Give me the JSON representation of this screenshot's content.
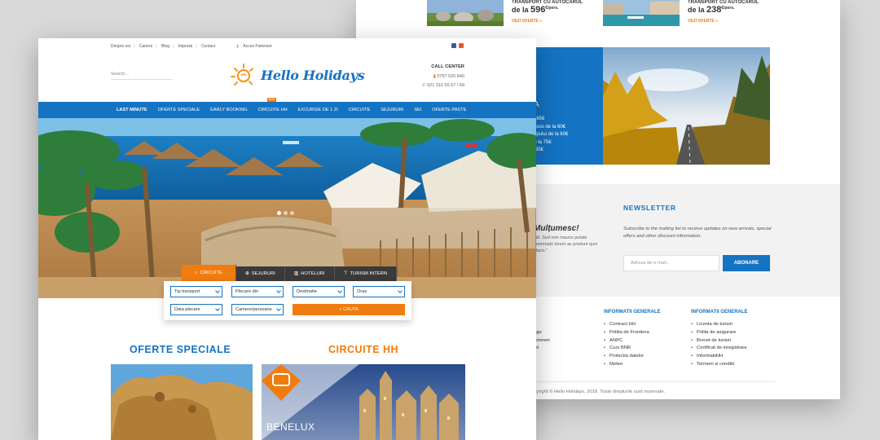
{
  "back": {
    "cards": [
      {
        "title": "TRANSPORT CU AUTOCARUL",
        "price_prefix": "de la",
        "price": "596",
        "price_unit": "€/pers.",
        "more": "VEZI OFERTE »"
      },
      {
        "title": "TRANSPORT CU AUTOCARUL",
        "price_prefix": "de la",
        "price": "238",
        "price_unit": "€/pers.",
        "more": "VEZI OFERTE »"
      }
    ],
    "promo": {
      "title_fragment": "IA",
      "lines": [
        "la 65€",
        "essos de la 60€",
        "impului de la 60€",
        "de la 75€",
        "a 95€"
      ]
    },
    "newsletter": {
      "title": "NEWSLETTER",
      "text": "Subscribe to the mailing list to receive updates on new arrivals, special offers and other discount information.",
      "placeholder": "Adresa de e-mail...",
      "button": "ABONARE"
    },
    "quote": {
      "title": "Mulțumesc!",
      "body": "elit. Sed non mauris putate commodo lorem ac pretium quis libero.\""
    },
    "footer": {
      "col0": [
        "p",
        "age",
        "arteneri",
        "ari",
        "t"
      ],
      "col1_title": "INFORMATII GENERALE",
      "col1": [
        "Contract HH",
        "Politia de Frontiera",
        "ANPC",
        "Curs BNR",
        "Protectia datelor",
        "Meteo"
      ],
      "col2_title": "INFORMATII GENERALE",
      "col2": [
        "Licenta de turism",
        "Polita de asigurare",
        "Brevet de turism",
        "Certificat de inregistrare",
        "InformatiiHH",
        "Termeni si conditii"
      ],
      "copyright": "pyright © Hello Holidays, 2018. Toate drepturile sunt rezervate."
    }
  },
  "front": {
    "util_links": [
      "Despre noi",
      "Cariere",
      "Blog",
      "Impresii",
      "Contact"
    ],
    "partner_link": "Acces Parteneri",
    "search_placeholder": "Search...",
    "logo_text": "Hello Holidays",
    "call_center": {
      "title": "CALL CENTER",
      "mobile": "0757 520 840",
      "phone": "021 316 55 67 / 69"
    },
    "nav": [
      "LAST MINUTE",
      "OFERTE SPECIALE",
      "EARLY BOOKING",
      "CIRCUITE HH",
      "EXCURSIE DE 1 ZI",
      "CIRCUITE",
      "SEJURURI",
      "SKI",
      "OFERTE PASTE"
    ],
    "nav_badge": "NOU",
    "tabs": [
      "CIRCUITE",
      "SEJURURI",
      "HOTELURI",
      "TURISM INTERN"
    ],
    "search": {
      "fields": [
        "Tip transport",
        "Plecare din",
        "Destinatie",
        "Oras",
        "Data plecare",
        "Camere/persoane"
      ],
      "button": "CAUTA"
    },
    "sections": {
      "left": "OFERTE SPECIALE",
      "right": "CIRCUITE HH"
    },
    "benelux": "BENELUX"
  },
  "colors": {
    "brand_blue": "#1473c2",
    "accent_orange": "#f07c0f"
  }
}
